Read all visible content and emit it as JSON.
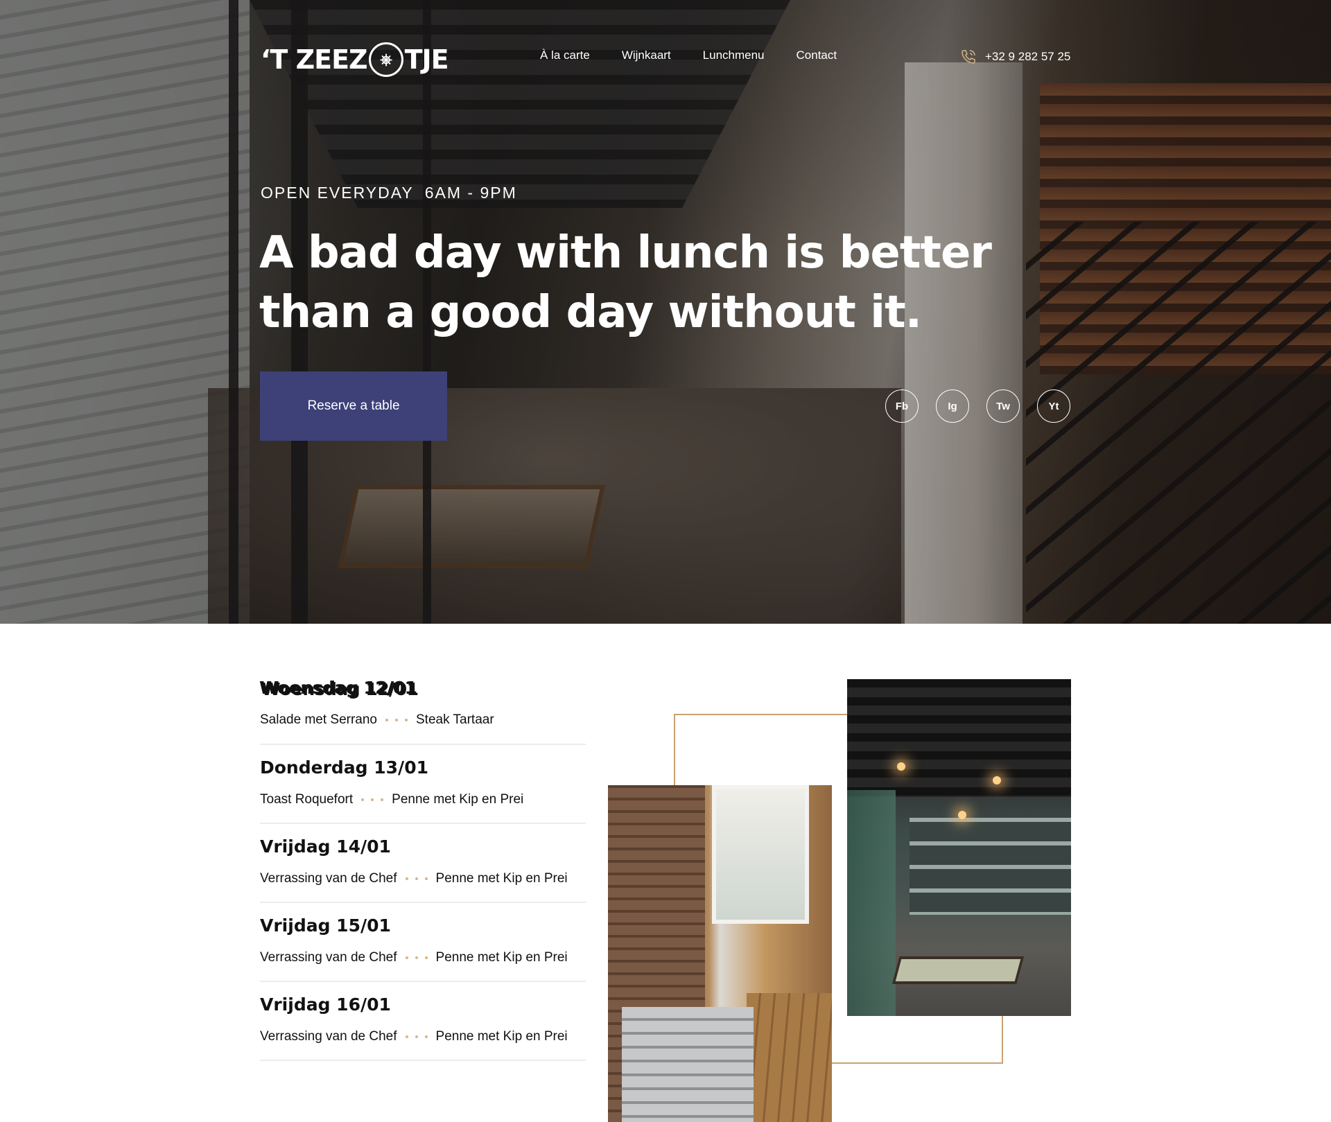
{
  "hero": {
    "logo": {
      "left": "‘T ZEEZ",
      "right": "TJE",
      "emblem": "ship-wheel-icon"
    },
    "nav": [
      "À la carte",
      "Wijnkaart",
      "Lunchmenu",
      "Contact"
    ],
    "phone": {
      "icon": "phone-icon",
      "number": "+32 9 282 57 25"
    },
    "hours": {
      "label": "OPEN EVERYDAY",
      "time": "6AM - 9PM"
    },
    "headline": "A bad day with lunch is better than a good day without it.",
    "cta": "Reserve a table",
    "socials": [
      "Fb",
      "Ig",
      "Tw",
      "Yt"
    ],
    "accent_color": "#3d4178"
  },
  "lunchmenu": {
    "divider_color": "#d6b58b",
    "frame_color": "#c8a272",
    "days": [
      {
        "title": "Woensdag 12/01",
        "dish1": "Salade met Serrano",
        "dish2": "Steak Tartaar"
      },
      {
        "title": "Donderdag 13/01",
        "dish1": "Toast Roquefort",
        "dish2": "Penne met Kip en Prei"
      },
      {
        "title": "Vrijdag 14/01",
        "dish1": "Verrassing van de Chef",
        "dish2": "Penne met Kip en Prei"
      },
      {
        "title": "Vrijdag 15/01",
        "dish1": "Verrassing van de Chef",
        "dish2": "Penne met Kip en Prei"
      },
      {
        "title": "Vrijdag 16/01",
        "dish1": "Verrassing van de Chef",
        "dish2": "Penne met Kip en Prei"
      }
    ]
  }
}
